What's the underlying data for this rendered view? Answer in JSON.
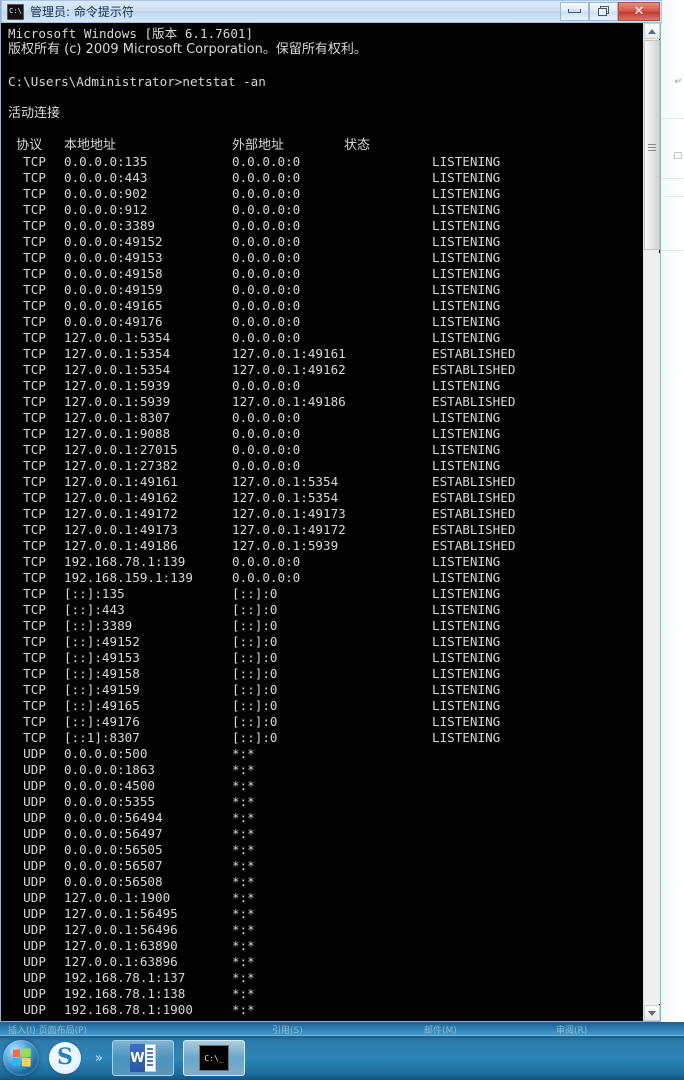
{
  "window": {
    "title": "管理员: 命令提示符",
    "icon": "cmd-icon",
    "icon_label": "C:\\",
    "buttons": {
      "minimize": "最小化",
      "restore": "还原",
      "close": "关闭"
    }
  },
  "console": {
    "banner": [
      "Microsoft Windows [版本 6.1.7601]",
      "版权所有 (c) 2009 Microsoft Corporation。保留所有权利。"
    ],
    "prompt": "C:\\Users\\Administrator>",
    "command": "netstat -an",
    "section_title": "活动连接",
    "headers": {
      "proto": "  协议",
      "local": "本地地址",
      "foreign": "外部地址",
      "state": "状态"
    },
    "rows": [
      {
        "proto": "TCP",
        "local": "0.0.0.0:135",
        "foreign": "0.0.0.0:0",
        "state": "LISTENING"
      },
      {
        "proto": "TCP",
        "local": "0.0.0.0:443",
        "foreign": "0.0.0.0:0",
        "state": "LISTENING"
      },
      {
        "proto": "TCP",
        "local": "0.0.0.0:902",
        "foreign": "0.0.0.0:0",
        "state": "LISTENING"
      },
      {
        "proto": "TCP",
        "local": "0.0.0.0:912",
        "foreign": "0.0.0.0:0",
        "state": "LISTENING"
      },
      {
        "proto": "TCP",
        "local": "0.0.0.0:3389",
        "foreign": "0.0.0.0:0",
        "state": "LISTENING"
      },
      {
        "proto": "TCP",
        "local": "0.0.0.0:49152",
        "foreign": "0.0.0.0:0",
        "state": "LISTENING"
      },
      {
        "proto": "TCP",
        "local": "0.0.0.0:49153",
        "foreign": "0.0.0.0:0",
        "state": "LISTENING"
      },
      {
        "proto": "TCP",
        "local": "0.0.0.0:49158",
        "foreign": "0.0.0.0:0",
        "state": "LISTENING"
      },
      {
        "proto": "TCP",
        "local": "0.0.0.0:49159",
        "foreign": "0.0.0.0:0",
        "state": "LISTENING"
      },
      {
        "proto": "TCP",
        "local": "0.0.0.0:49165",
        "foreign": "0.0.0.0:0",
        "state": "LISTENING"
      },
      {
        "proto": "TCP",
        "local": "0.0.0.0:49176",
        "foreign": "0.0.0.0:0",
        "state": "LISTENING"
      },
      {
        "proto": "TCP",
        "local": "127.0.0.1:5354",
        "foreign": "0.0.0.0:0",
        "state": "LISTENING"
      },
      {
        "proto": "TCP",
        "local": "127.0.0.1:5354",
        "foreign": "127.0.0.1:49161",
        "state": "ESTABLISHED"
      },
      {
        "proto": "TCP",
        "local": "127.0.0.1:5354",
        "foreign": "127.0.0.1:49162",
        "state": "ESTABLISHED"
      },
      {
        "proto": "TCP",
        "local": "127.0.0.1:5939",
        "foreign": "0.0.0.0:0",
        "state": "LISTENING"
      },
      {
        "proto": "TCP",
        "local": "127.0.0.1:5939",
        "foreign": "127.0.0.1:49186",
        "state": "ESTABLISHED"
      },
      {
        "proto": "TCP",
        "local": "127.0.0.1:8307",
        "foreign": "0.0.0.0:0",
        "state": "LISTENING"
      },
      {
        "proto": "TCP",
        "local": "127.0.0.1:9088",
        "foreign": "0.0.0.0:0",
        "state": "LISTENING"
      },
      {
        "proto": "TCP",
        "local": "127.0.0.1:27015",
        "foreign": "0.0.0.0:0",
        "state": "LISTENING"
      },
      {
        "proto": "TCP",
        "local": "127.0.0.1:27382",
        "foreign": "0.0.0.0:0",
        "state": "LISTENING"
      },
      {
        "proto": "TCP",
        "local": "127.0.0.1:49161",
        "foreign": "127.0.0.1:5354",
        "state": "ESTABLISHED"
      },
      {
        "proto": "TCP",
        "local": "127.0.0.1:49162",
        "foreign": "127.0.0.1:5354",
        "state": "ESTABLISHED"
      },
      {
        "proto": "TCP",
        "local": "127.0.0.1:49172",
        "foreign": "127.0.0.1:49173",
        "state": "ESTABLISHED"
      },
      {
        "proto": "TCP",
        "local": "127.0.0.1:49173",
        "foreign": "127.0.0.1:49172",
        "state": "ESTABLISHED"
      },
      {
        "proto": "TCP",
        "local": "127.0.0.1:49186",
        "foreign": "127.0.0.1:5939",
        "state": "ESTABLISHED"
      },
      {
        "proto": "TCP",
        "local": "192.168.78.1:139",
        "foreign": "0.0.0.0:0",
        "state": "LISTENING"
      },
      {
        "proto": "TCP",
        "local": "192.168.159.1:139",
        "foreign": "0.0.0.0:0",
        "state": "LISTENING"
      },
      {
        "proto": "TCP",
        "local": "[::]:135",
        "foreign": "[::]:0",
        "state": "LISTENING"
      },
      {
        "proto": "TCP",
        "local": "[::]:443",
        "foreign": "[::]:0",
        "state": "LISTENING"
      },
      {
        "proto": "TCP",
        "local": "[::]:3389",
        "foreign": "[::]:0",
        "state": "LISTENING"
      },
      {
        "proto": "TCP",
        "local": "[::]:49152",
        "foreign": "[::]:0",
        "state": "LISTENING"
      },
      {
        "proto": "TCP",
        "local": "[::]:49153",
        "foreign": "[::]:0",
        "state": "LISTENING"
      },
      {
        "proto": "TCP",
        "local": "[::]:49158",
        "foreign": "[::]:0",
        "state": "LISTENING"
      },
      {
        "proto": "TCP",
        "local": "[::]:49159",
        "foreign": "[::]:0",
        "state": "LISTENING"
      },
      {
        "proto": "TCP",
        "local": "[::]:49165",
        "foreign": "[::]:0",
        "state": "LISTENING"
      },
      {
        "proto": "TCP",
        "local": "[::]:49176",
        "foreign": "[::]:0",
        "state": "LISTENING"
      },
      {
        "proto": "TCP",
        "local": "[::1]:8307",
        "foreign": "[::]:0",
        "state": "LISTENING"
      },
      {
        "proto": "UDP",
        "local": "0.0.0.0:500",
        "foreign": "*:*",
        "state": ""
      },
      {
        "proto": "UDP",
        "local": "0.0.0.0:1863",
        "foreign": "*:*",
        "state": ""
      },
      {
        "proto": "UDP",
        "local": "0.0.0.0:4500",
        "foreign": "*:*",
        "state": ""
      },
      {
        "proto": "UDP",
        "local": "0.0.0.0:5355",
        "foreign": "*:*",
        "state": ""
      },
      {
        "proto": "UDP",
        "local": "0.0.0.0:56494",
        "foreign": "*:*",
        "state": ""
      },
      {
        "proto": "UDP",
        "local": "0.0.0.0:56497",
        "foreign": "*:*",
        "state": ""
      },
      {
        "proto": "UDP",
        "local": "0.0.0.0:56505",
        "foreign": "*:*",
        "state": ""
      },
      {
        "proto": "UDP",
        "local": "0.0.0.0:56507",
        "foreign": "*:*",
        "state": ""
      },
      {
        "proto": "UDP",
        "local": "0.0.0.0:56508",
        "foreign": "*:*",
        "state": ""
      },
      {
        "proto": "UDP",
        "local": "127.0.0.1:1900",
        "foreign": "*:*",
        "state": ""
      },
      {
        "proto": "UDP",
        "local": "127.0.0.1:56495",
        "foreign": "*:*",
        "state": ""
      },
      {
        "proto": "UDP",
        "local": "127.0.0.1:56496",
        "foreign": "*:*",
        "state": ""
      },
      {
        "proto": "UDP",
        "local": "127.0.0.1:63890",
        "foreign": "*:*",
        "state": ""
      },
      {
        "proto": "UDP",
        "local": "127.0.0.1:63896",
        "foreign": "*:*",
        "state": ""
      },
      {
        "proto": "UDP",
        "local": "192.168.78.1:137",
        "foreign": "*:*",
        "state": ""
      },
      {
        "proto": "UDP",
        "local": "192.168.78.1:138",
        "foreign": "*:*",
        "state": ""
      },
      {
        "proto": "UDP",
        "local": "192.168.78.1:1900",
        "foreign": "*:*",
        "state": ""
      }
    ]
  },
  "scrollbar": {
    "up_arrow": "▲",
    "down_arrow": "▼"
  },
  "taskbar": {
    "start": "开始",
    "ime": "S",
    "overflow": "»",
    "items": [
      {
        "name": "word",
        "label": "W"
      },
      {
        "name": "command-prompt",
        "label": "C:\\_"
      }
    ]
  },
  "colors": {
    "console_bg": "#000000",
    "console_fg": "#d8d8d8",
    "titlebar": "#cfe0f3",
    "close_button": "#c13b30",
    "taskbar": "#2f86b8"
  }
}
